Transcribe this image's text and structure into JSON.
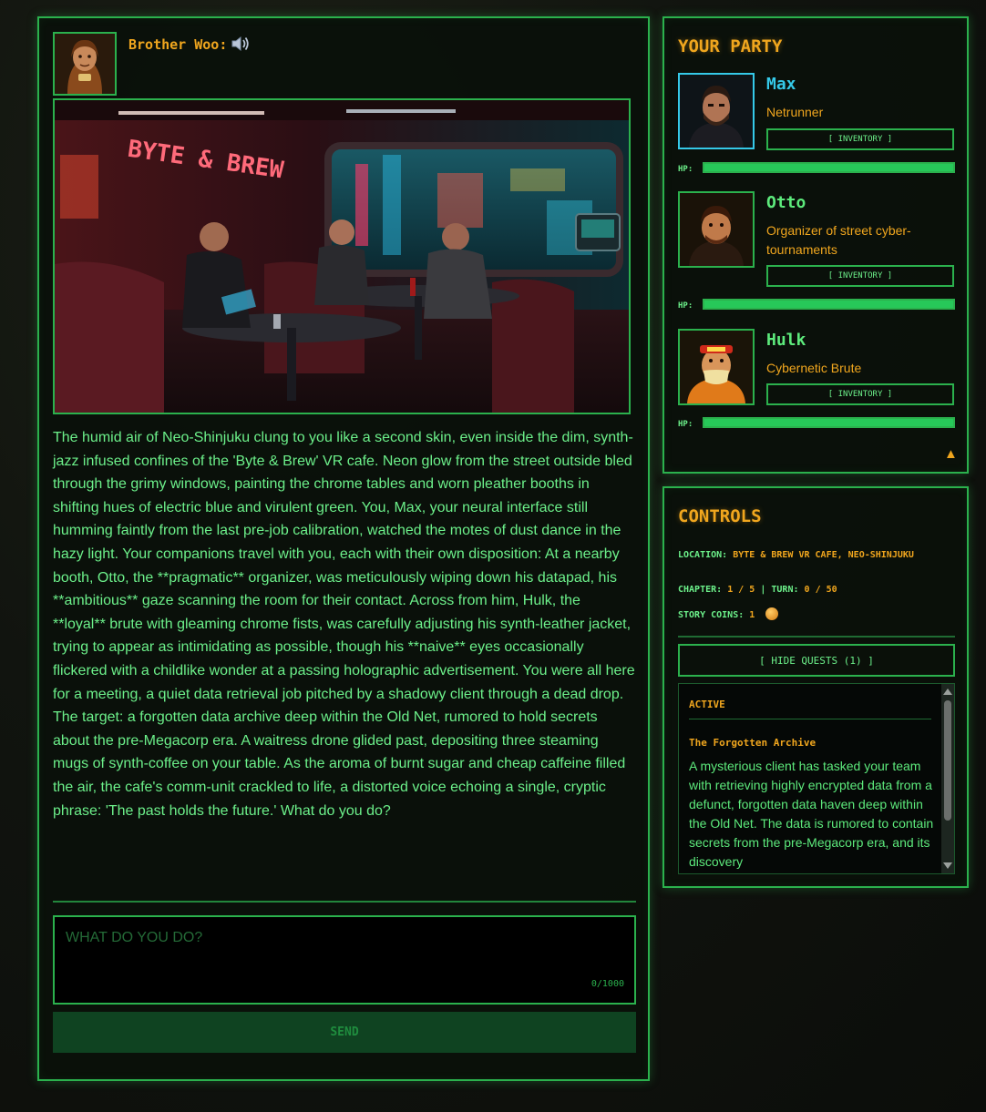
{
  "narrator": {
    "name": "Brother Woo:",
    "speaker_icon": "speaker-icon",
    "portrait": "monk-portrait"
  },
  "scene": {
    "sign_text": "BYTE & BREW",
    "image": "cyberpunk-cafe-scene"
  },
  "story": {
    "text": "The humid air of Neo-Shinjuku clung to you like a second skin, even inside the dim, synth-jazz infused confines of the 'Byte & Brew' VR cafe. Neon glow from the street outside bled through the grimy windows, painting the chrome tables and worn pleather booths in shifting hues of electric blue and virulent green. You, Max, your neural interface still humming faintly from the last pre-job calibration, watched the motes of dust dance in the hazy light. Your companions travel with you, each with their own disposition: At a nearby booth, Otto, the **pragmatic** organizer, was meticulously wiping down his datapad, his **ambitious** gaze scanning the room for their contact. Across from him, Hulk, the **loyal** brute with gleaming chrome fists, was carefully adjusting his synth-leather jacket, trying to appear as intimidating as possible, though his **naive** eyes occasionally flickered with a childlike wonder at a passing holographic advertisement. You were all here for a meeting, a quiet data retrieval job pitched by a shadowy client through a dead drop. The target: a forgotten data archive deep within the Old Net, rumored to hold secrets about the pre-Megacorp era. A waitress drone glided past, depositing three steaming mugs of synth-coffee on your table. As the aroma of burnt sugar and cheap caffeine filled the air, the cafe's comm-unit crackled to life, a distorted voice echoing a single, cryptic phrase: 'The past holds the future.' What do you do?"
  },
  "input": {
    "placeholder": "WHAT DO YOU DO?",
    "char_count": "0/1000",
    "value": ""
  },
  "send_label": "SEND",
  "party": {
    "title": "YOUR PARTY",
    "hp_label": "HP:",
    "inventory_label": "[ INVENTORY ]",
    "members": [
      {
        "name": "Max",
        "role": "Netrunner",
        "hp": 1.0,
        "selected": true
      },
      {
        "name": "Otto",
        "role": "Organizer of street cyber-tournaments",
        "hp": 1.0,
        "selected": false
      },
      {
        "name": "Hulk",
        "role": "Cybernetic Brute",
        "hp": 1.0,
        "selected": false
      }
    ],
    "collapse_icon": "triangle-up-icon"
  },
  "controls": {
    "title": "CONTROLS",
    "location_label": "LOCATION:",
    "location_value": "BYTE & BREW VR CAFE, NEO-SHINJUKU",
    "chapter_label": "CHAPTER:",
    "chapter_value": "1 / 5",
    "turn_sep": "| TURN:",
    "turn_value": "0 / 50",
    "coins_label": "STORY COINS:",
    "coins_value": "1",
    "hide_quests_label": "[ HIDE QUESTS (1) ]"
  },
  "quests": {
    "status": "ACTIVE",
    "items": [
      {
        "title": "The Forgotten Archive",
        "description": "A mysterious client has tasked your team with retrieving highly encrypted data from a defunct, forgotten data haven deep within the Old Net. The data is rumored to contain secrets from the pre-Megacorp era, and its discovery"
      }
    ]
  },
  "colors": {
    "accent_green": "#2bb14d",
    "text_green": "#6cf08a",
    "amber": "#f0a61e",
    "cyan": "#35c9e8"
  }
}
